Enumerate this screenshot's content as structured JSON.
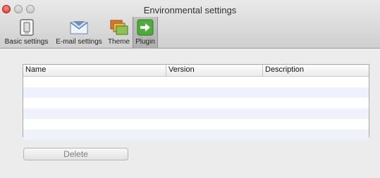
{
  "window": {
    "title": "Environmental settings"
  },
  "toolbar": {
    "items": [
      {
        "label": "Basic settings",
        "icon": "switch-icon"
      },
      {
        "label": "E-mail settings",
        "icon": "envelope-icon"
      },
      {
        "label": "Theme",
        "icon": "theme-windows-icon"
      },
      {
        "label": "Plugin",
        "icon": "plugin-arrow-icon",
        "selected": true
      }
    ]
  },
  "table": {
    "columns": [
      "Name",
      "Version",
      "Description"
    ],
    "rows": []
  },
  "actions": {
    "delete_label": "Delete"
  },
  "colors": {
    "close": "#e0443a",
    "row_alt": "#eef3fb",
    "plugin_green": "#4cae37"
  }
}
